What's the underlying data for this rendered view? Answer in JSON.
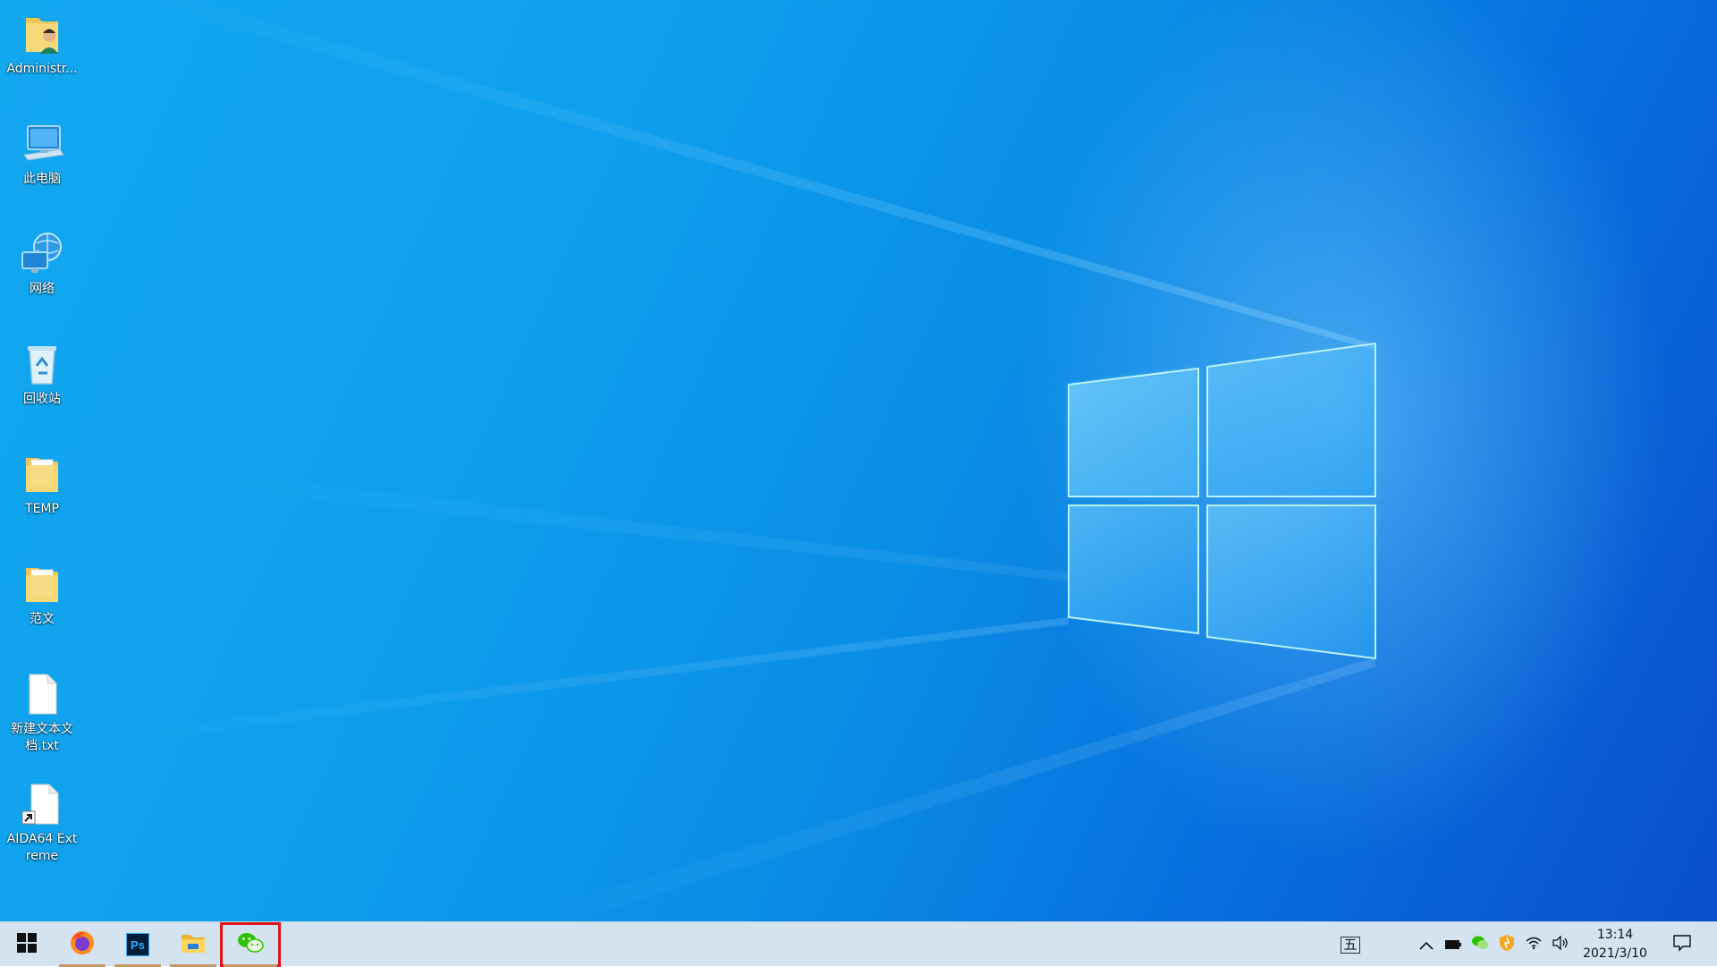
{
  "desktop": {
    "icons": [
      {
        "label": "Administr...",
        "icon": "user-folder-icon"
      },
      {
        "label": "此电脑",
        "icon": "this-pc-icon"
      },
      {
        "label": "网络",
        "icon": "network-icon"
      },
      {
        "label": "回收站",
        "icon": "recycle-bin-icon"
      },
      {
        "label": "TEMP",
        "icon": "folder-icon"
      },
      {
        "label": "范文",
        "icon": "folder-icon"
      },
      {
        "label": "新建文本文档.txt",
        "icon": "text-file-icon"
      },
      {
        "label": "AIDA64 Extreme",
        "icon": "shortcut-file-icon"
      }
    ]
  },
  "taskbar": {
    "start": {
      "icon": "windows-start-icon"
    },
    "pinned": [
      {
        "name": "firefox",
        "icon": "firefox-icon",
        "running": true
      },
      {
        "name": "photoshop",
        "icon": "photoshop-icon",
        "label": "Ps",
        "running": true
      },
      {
        "name": "file-explorer",
        "icon": "file-explorer-icon",
        "running": true
      },
      {
        "name": "wechat",
        "icon": "wechat-icon",
        "running": true,
        "highlighted": true
      }
    ],
    "ime_indicator": "五",
    "tray": {
      "icons": [
        "chevron-up-icon",
        "battery-icon",
        "wechat-tray-icon",
        "shield-icon",
        "wifi-icon",
        "volume-icon"
      ]
    },
    "clock": {
      "time": "13:14",
      "date": "2021/3/10"
    },
    "notification": {
      "icon": "notification-icon"
    }
  },
  "colors": {
    "desktop_accent": "#0a8de6",
    "taskbar_bg": "#d3e3ef",
    "running_indicator": "#c79a63",
    "highlight_box": "#e0141e",
    "photoshop_blue": "#31a8ff",
    "wechat_green": "#2dc100"
  }
}
